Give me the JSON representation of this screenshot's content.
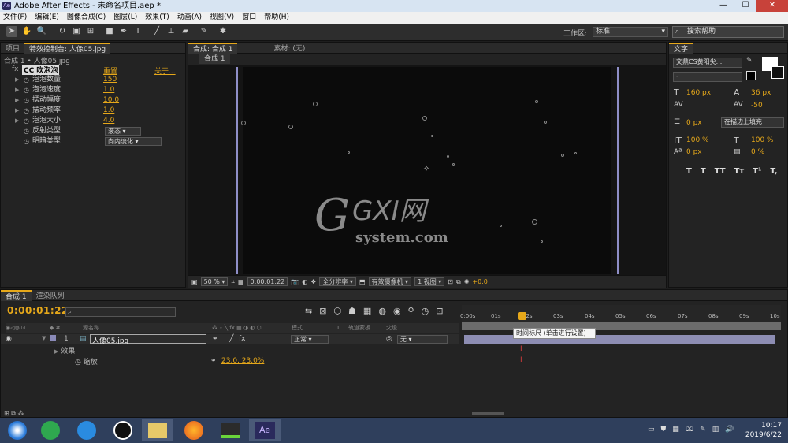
{
  "window": {
    "title": "Adobe After Effects - 未命名项目.aep *"
  },
  "menu": [
    "文件(F)",
    "编辑(E)",
    "图像合成(C)",
    "图层(L)",
    "效果(T)",
    "动画(A)",
    "视图(V)",
    "窗口",
    "帮助(H)"
  ],
  "toolbar": {
    "workspace_label": "工作区:",
    "workspace_value": "标准",
    "search_placeholder": "搜索帮助"
  },
  "left_panel": {
    "tabs": [
      "项目",
      "特效控制台: 人像05.jpg"
    ],
    "breadcrumb": "合成 1 • 人像05.jpg",
    "effect": {
      "fx": "fx",
      "name": "CC 吹泡泡",
      "reset": "重置",
      "about": "关于..."
    },
    "props": [
      {
        "name": "泡泡数量",
        "value": "150"
      },
      {
        "name": "泡泡速度",
        "value": "1.0"
      },
      {
        "name": "摆动幅度",
        "value": "10.0"
      },
      {
        "name": "摆动频率",
        "value": "1.0"
      },
      {
        "name": "泡泡大小",
        "value": "4.0"
      },
      {
        "name": "反射类型",
        "value": "液态"
      },
      {
        "name": "明暗类型",
        "value": "向内淡化"
      }
    ]
  },
  "viewer": {
    "tab": "合成: 合成 1",
    "tab2": "素材: (无)",
    "subtab": "合成 1",
    "zoom": "50 %",
    "timecode": "0:00:01:22",
    "resolution": "全分辨率",
    "camera": "有效摄像机",
    "views": "1 视图",
    "exposure": "+0.0"
  },
  "watermark": {
    "big": "GXI网",
    "small": "system.com"
  },
  "text_panel": {
    "tab": "文字",
    "font": "文鼎CS黄阳尖...",
    "font_style": "-",
    "size": "160 px",
    "leading": "36 px",
    "tracking": "-50",
    "stroke": "0 px",
    "stroke_mode": "在描边上填充",
    "vscale": "100 %",
    "hscale": "100 %",
    "baseline": "0 px",
    "tsume": "0 %",
    "styles": [
      "T",
      "T",
      "TT",
      "Tт",
      "T¹",
      "T,"
    ]
  },
  "timeline": {
    "tabs": [
      "合成 1",
      "渲染队列"
    ],
    "timecode": "0:00:01:22",
    "search_placeholder": "",
    "columns": {
      "source": "源名称",
      "mode": "模式",
      "t": "T",
      "trkmat": "轨道蒙板",
      "parent": "父级"
    },
    "layer": {
      "index": "1",
      "name": "人像05.jpg",
      "mode": "正常",
      "parent": "无"
    },
    "effects_label": "效果",
    "scale_label": "缩放",
    "scale_value": "23.0, 23.0%",
    "ticks": [
      "0:00s",
      "01s",
      "02s",
      "03s",
      "04s",
      "05s",
      "06s",
      "07s",
      "08s",
      "09s",
      "10s"
    ],
    "tooltip": "时间标尺 (单击进行设置)"
  },
  "taskbar": {
    "time": "10:17",
    "date": "2019/6/22"
  }
}
